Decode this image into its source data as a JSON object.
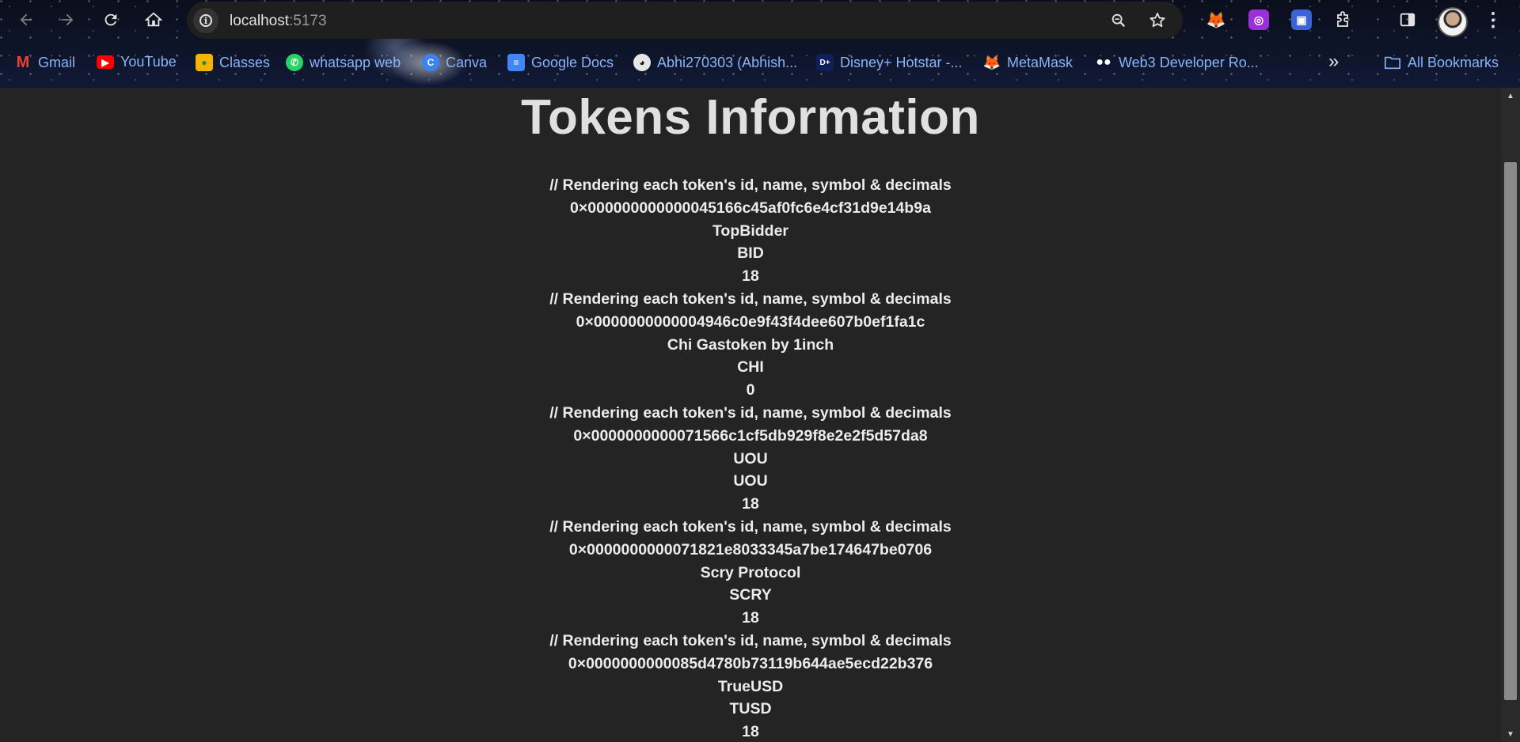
{
  "browser": {
    "url_host": "localhost",
    "url_port": ":5173",
    "bookmarks": [
      {
        "label": "Gmail",
        "icon": "gmail-icon"
      },
      {
        "label": "YouTube",
        "icon": "youtube-icon"
      },
      {
        "label": "Classes",
        "icon": "classroom-icon"
      },
      {
        "label": "whatsapp web",
        "icon": "whatsapp-icon"
      },
      {
        "label": "Canva",
        "icon": "canva-icon"
      },
      {
        "label": "Google Docs",
        "icon": "google-docs-icon"
      },
      {
        "label": "Abhi270303 (Abhish...",
        "icon": "github-icon"
      },
      {
        "label": "Disney+ Hotstar -...",
        "icon": "hotstar-icon"
      },
      {
        "label": "MetaMask",
        "icon": "metamask-icon"
      },
      {
        "label": "Web3 Developer Ro...",
        "icon": "medium-icon"
      }
    ],
    "all_bookmarks": "All Bookmarks",
    "more_glyph": "»"
  },
  "page": {
    "title": "Tokens Information",
    "tokens": [
      {
        "comment": "// Rendering each token's id, name, symbol & decimals",
        "id": "0×000000000000045166c45af0fc6e4cf31d9e14b9a",
        "name": "TopBidder",
        "symbol": "BID",
        "decimals": "18"
      },
      {
        "comment": "// Rendering each token's id, name, symbol & decimals",
        "id": "0×0000000000004946c0e9f43f4dee607b0ef1fa1c",
        "name": "Chi Gastoken by 1inch",
        "symbol": "CHI",
        "decimals": "0"
      },
      {
        "comment": "// Rendering each token's id, name, symbol & decimals",
        "id": "0×0000000000071566c1cf5db929f8e2e2f5d57da8",
        "name": "UOU",
        "symbol": "UOU",
        "decimals": "18"
      },
      {
        "comment": "// Rendering each token's id, name, symbol & decimals",
        "id": "0×0000000000071821e8033345a7be174647be0706",
        "name": "Scry Protocol",
        "symbol": "SCRY",
        "decimals": "18"
      },
      {
        "comment": "// Rendering each token's id, name, symbol & decimals",
        "id": "0×0000000000085d4780b73119b644ae5ecd22b376",
        "name": "TrueUSD",
        "symbol": "TUSD",
        "decimals": "18"
      }
    ]
  },
  "colors": {
    "page_bg": "#242424",
    "text": "#ececec",
    "bookmark_text": "#8ab4f8",
    "omnibox_bg": "#1f1f1f"
  }
}
